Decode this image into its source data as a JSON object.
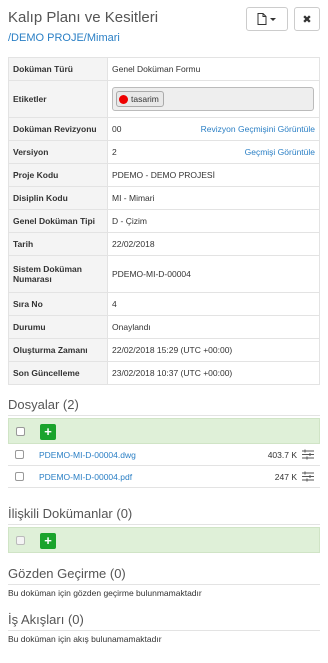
{
  "header": {
    "title": "Kalıp Planı ve Kesitleri",
    "breadcrumb": "/DEMO PROJE/Mimari",
    "file_button_icon": "file-dropdown-icon",
    "close_button_label": "✖"
  },
  "meta": {
    "doc_type_label": "Doküman Türü",
    "doc_type_value": "Genel Doküman Formu",
    "tags_label": "Etiketler",
    "tag": "tasarim",
    "revision_label": "Doküman Revizyonu",
    "revision_value": "00",
    "revision_link": "Revizyon Geçmişini Görüntüle",
    "version_label": "Versiyon",
    "version_value": "2",
    "version_link": "Geçmişi Görüntüle",
    "project_code_label": "Proje Kodu",
    "project_code_value": "PDEMO - DEMO PROJESİ",
    "discipline_label": "Disiplin Kodu",
    "discipline_value": "MI - Mimari",
    "general_type_label": "Genel Doküman Tipi",
    "general_type_value": "D - Çizim",
    "date_label": "Tarih",
    "date_value": "22/02/2018",
    "system_number_label": "Sistem Doküman Numarası",
    "system_number_value": "PDEMO-MI-D-00004",
    "seq_label": "Sıra No",
    "seq_value": "4",
    "status_label": "Durumu",
    "status_value": "Onaylandı",
    "created_label": "Oluşturma Zamanı",
    "created_value": "22/02/2018 15:29 (UTC +00:00)",
    "updated_label": "Son Güncelleme",
    "updated_value": "23/02/2018 10:37 (UTC +00:00)"
  },
  "files": {
    "title": "Dosyalar (2)",
    "items": [
      {
        "name": "PDEMO-MI-D-00004.dwg",
        "size": "403.7 K"
      },
      {
        "name": "PDEMO-MI-D-00004.pdf",
        "size": "247 K"
      }
    ]
  },
  "related": {
    "title": "İlişkili Dokümanlar (0)"
  },
  "review": {
    "title": "Gözden Geçirme (0)",
    "empty": "Bu doküman için gözden geçirme bulunmamaktadır"
  },
  "workflow": {
    "title": "İş Akışları (0)",
    "empty": "Bu doküman için akış bulunamamaktadır"
  }
}
